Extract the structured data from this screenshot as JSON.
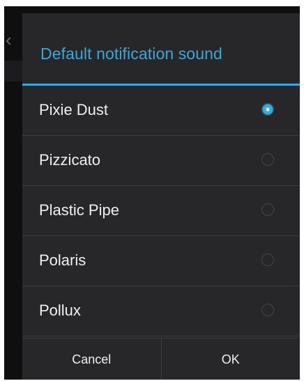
{
  "dialog": {
    "title": "Default notification sound",
    "options": [
      {
        "label": "Pixie Dust",
        "selected": true
      },
      {
        "label": "Pizzicato",
        "selected": false
      },
      {
        "label": "Plastic Pipe",
        "selected": false
      },
      {
        "label": "Polaris",
        "selected": false
      },
      {
        "label": "Pollux",
        "selected": false
      }
    ],
    "buttons": {
      "cancel": "Cancel",
      "ok": "OK"
    }
  },
  "background": {
    "back_icon": "chevron-left-icon"
  },
  "colors": {
    "accent": "#33a9e0",
    "dialog_bg": "#272729",
    "text": "#f0f0f0"
  }
}
